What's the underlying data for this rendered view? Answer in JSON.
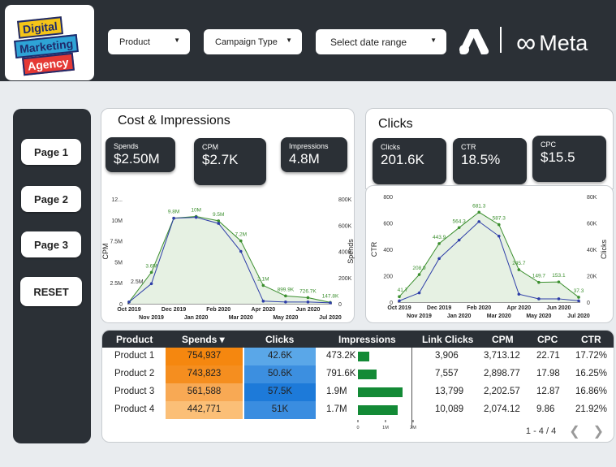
{
  "logo": {
    "line1": "Digital",
    "line2": "Marketing",
    "line3": "Agency"
  },
  "filters": {
    "product": "Product",
    "campaign_type": "Campaign Type",
    "date_range": "Select date range"
  },
  "brand": {
    "meta_text": "Meta",
    "meta_symbol": "∞"
  },
  "nav": {
    "page1": "Page 1",
    "page2": "Page 2",
    "page3": "Page 3",
    "reset": "RESET"
  },
  "cost_panel": {
    "title": "Cost & Impressions",
    "kpis": [
      {
        "label": "Spends",
        "value": "$2.50M"
      },
      {
        "label": "CPM",
        "value": "$2.7K"
      },
      {
        "label": "Impressions",
        "value": "4.8M"
      }
    ]
  },
  "clicks_panel": {
    "title": "Clicks",
    "kpis": [
      {
        "label": "Clicks",
        "value": "201.6K"
      },
      {
        "label": "CTR",
        "value": "18.5%"
      },
      {
        "label": "CPC",
        "value": "$15.5"
      }
    ]
  },
  "chart_data": [
    {
      "type": "line",
      "name": "cost-impressions",
      "x_ticks_top": [
        "Oct 2019",
        "Dec 2019",
        "Feb 2020",
        "Apr 2020",
        "Jun 2020"
      ],
      "x_ticks_bottom": [
        "Nov 2019",
        "Jan 2020",
        "Mar 2020",
        "May 2020",
        "Jul 2020"
      ],
      "ylabel_left": "CPM",
      "ylabel_right": "Spends",
      "y_left_ticks": [
        "12...",
        "10M",
        "7.5M",
        "5M",
        "2.5M",
        "0"
      ],
      "y_right_ticks": [
        "800K",
        "600K",
        "400K",
        "200K",
        "0"
      ],
      "series": [
        {
          "color": "#3c8f2f",
          "type": "area",
          "values": [
            0.2,
            3.6,
            9.8,
            10,
            9.5,
            7.2,
            2.1,
            0.9,
            0.7,
            0.15
          ],
          "labels": [
            "",
            "3.6M",
            "9.8M",
            "10M",
            "9.5M",
            "7.2M",
            "2.1M",
            "899.9K",
            "726.7K",
            "147.8K"
          ]
        },
        {
          "color": "#2e3ea8",
          "type": "line",
          "values": [
            0.2,
            2.3,
            9.8,
            9.9,
            9.2,
            6.0,
            0.3,
            0.2,
            0.2,
            0.1
          ],
          "labels": [
            "",
            "",
            "",
            "",
            "",
            "",
            "",
            "",
            "",
            ""
          ]
        }
      ],
      "extra_label": "2.5M",
      "ylim": [
        0,
        12
      ]
    },
    {
      "type": "line",
      "name": "clicks",
      "x_ticks_top": [
        "Oct 2019",
        "Dec 2019",
        "Feb 2020",
        "Apr 2020",
        "Jun 2020"
      ],
      "x_ticks_bottom": [
        "Nov 2019",
        "Jan 2020",
        "Mar 2020",
        "May 2020",
        "Jul 2020"
      ],
      "ylabel_left": "CTR",
      "ylabel_right": "Clicks",
      "y_left_ticks": [
        "800",
        "600",
        "400",
        "200",
        "0"
      ],
      "y_right_ticks": [
        "80K",
        "60K",
        "40K",
        "20K",
        "0"
      ],
      "series": [
        {
          "color": "#3c8f2f",
          "type": "area",
          "values": [
            41.7,
            208.9,
            443.9,
            564.3,
            681.3,
            587.3,
            245.7,
            149.7,
            153.1,
            37.3
          ],
          "labels": [
            "41.7",
            "208.9",
            "443.9",
            "564.3",
            "681.3",
            "587.3",
            "245.7",
            "149.7",
            "153.1",
            "37.3"
          ]
        },
        {
          "color": "#2e3ea8",
          "type": "line",
          "values": [
            10,
            70,
            330,
            470,
            610,
            500,
            60,
            25,
            25,
            10
          ],
          "labels": [
            "",
            "",
            "",
            "",
            "",
            "",
            "",
            "",
            "",
            ""
          ]
        }
      ],
      "ylim": [
        0,
        800
      ]
    }
  ],
  "table": {
    "headers": [
      "Product",
      "Spends ▾",
      "Clicks",
      "Impressions",
      "Link Clicks",
      "CPM",
      "CPC",
      "CTR"
    ],
    "rows": [
      {
        "product": "Product 1",
        "spends": "754,937",
        "clicks": "42.6K",
        "impressions": "473.2K",
        "imp_value": 473.2,
        "link_clicks": "3,906",
        "cpm": "3,713.12",
        "cpc": "22.71",
        "ctr": "17.72%",
        "spend_color": "#f5870f",
        "click_color": "#5aa7e8"
      },
      {
        "product": "Product 2",
        "spends": "743,823",
        "clicks": "50.6K",
        "impressions": "791.6K",
        "imp_value": 791.6,
        "link_clicks": "7,557",
        "cpm": "2,898.77",
        "cpc": "17.98",
        "ctr": "16.25%",
        "spend_color": "#f58e1f",
        "click_color": "#3c8fe0"
      },
      {
        "product": "Product 3",
        "spends": "561,588",
        "clicks": "57.5K",
        "impressions": "1.9M",
        "imp_value": 1900,
        "link_clicks": "13,799",
        "cpm": "2,202.57",
        "cpc": "12.87",
        "ctr": "16.86%",
        "spend_color": "#f8a954",
        "click_color": "#1d7ad9"
      },
      {
        "product": "Product 4",
        "spends": "442,771",
        "clicks": "51K",
        "impressions": "1.7M",
        "imp_value": 1700,
        "link_clicks": "10,089",
        "cpm": "2,074.12",
        "cpc": "9.86",
        "ctr": "21.92%",
        "spend_color": "#fbbf77",
        "click_color": "#3a8de0"
      }
    ],
    "imp_axis": [
      "0",
      "1M",
      "2M"
    ],
    "imp_max": 2000,
    "pagination": "1 - 4 / 4"
  }
}
